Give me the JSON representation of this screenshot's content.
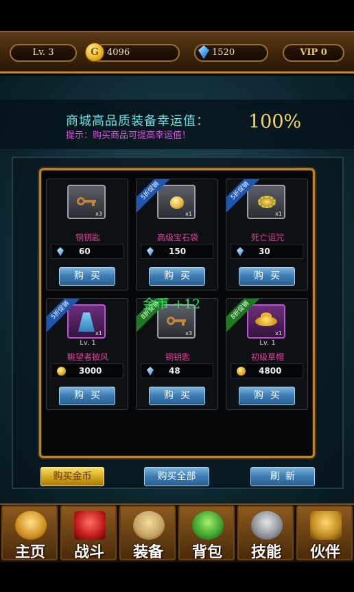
{
  "header": {
    "level": "Lv. 3",
    "gold": "4096",
    "gems": "1520",
    "vip": "VIP 0"
  },
  "luck": {
    "title": "商城高品质装备幸运值：",
    "hint": "提示：购买商品可提高幸运值！",
    "value": "100%"
  },
  "items": [
    {
      "name": "铜钥匙",
      "qty": "x3",
      "level": "",
      "currency": "gem",
      "price": "60",
      "ribbon": "",
      "art": "key",
      "rarity": "gray"
    },
    {
      "name": "高级宝石袋",
      "qty": "x1",
      "level": "",
      "currency": "gem",
      "price": "150",
      "ribbon": "5折促销",
      "ribbon_color": "#1e56b0",
      "art": "bag",
      "rarity": "gray"
    },
    {
      "name": "死亡诅咒",
      "qty": "x1",
      "level": "",
      "currency": "gem",
      "price": "30",
      "ribbon": "5折促销",
      "ribbon_color": "#1e56b0",
      "art": "chain",
      "rarity": "gray"
    },
    {
      "name": "眺望者披风",
      "qty": "x1",
      "level": "Lv. 1",
      "currency": "coin",
      "price": "3000",
      "ribbon": "5折促销",
      "ribbon_color": "#1e56b0",
      "art": "cloak",
      "rarity": "purple"
    },
    {
      "name": "铜钥匙",
      "qty": "x3",
      "level": "",
      "currency": "gem",
      "price": "48",
      "ribbon": "8折促销",
      "ribbon_color": "#1e7a20",
      "art": "key",
      "rarity": "gray"
    },
    {
      "name": "初级草帽",
      "qty": "x1",
      "level": "Lv. 1",
      "currency": "coin",
      "price": "4800",
      "ribbon": "8折促销",
      "ribbon_color": "#1e7a20",
      "art": "hat",
      "rarity": "purple"
    }
  ],
  "buy_label": "购买",
  "float_text": "金币 +12",
  "actions": {
    "buy_gold": "购买金币",
    "buy_all": "购买全部",
    "refresh": "刷新"
  },
  "nav": [
    {
      "label": "主页",
      "icon": "straw-hat-skull-icon"
    },
    {
      "label": "战斗",
      "icon": "pirate-flag-icon"
    },
    {
      "label": "装备",
      "icon": "equipment-icon"
    },
    {
      "label": "背包",
      "icon": "backpack-icon"
    },
    {
      "label": "技能",
      "icon": "hammer-skill-icon"
    },
    {
      "label": "伙伴",
      "icon": "partner-card-icon"
    }
  ]
}
